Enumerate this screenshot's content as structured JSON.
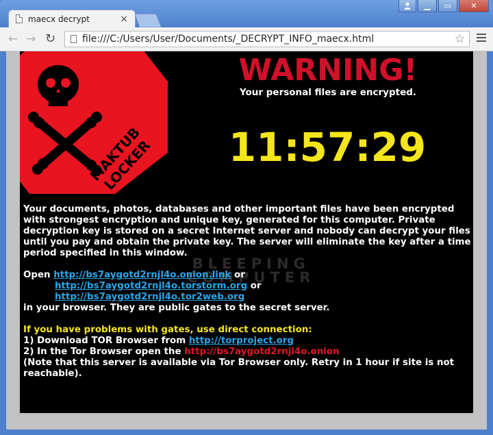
{
  "browser": {
    "tab_title": "maecx decrypt",
    "tab_close": "×",
    "url": "file:///C:/Users/User/Documents/_DECRYPT_INFO_maecx.html",
    "back_glyph": "←",
    "forward_glyph": "→",
    "reload_glyph": "↻",
    "star_glyph": "☆",
    "minimize_glyph": "▁",
    "maximize_glyph": "▭",
    "close_glyph": "✕",
    "user_glyph": "👤"
  },
  "logo": {
    "line1": "MAKTUB",
    "line2": "LOCKER",
    "color": "#e8141f"
  },
  "header": {
    "warning": "WARNING!",
    "subtitle": "Your personal files are encrypted."
  },
  "timer": "11:57:29",
  "watermark": {
    "line1": "BLEEPING",
    "line2": "COMPUTER"
  },
  "message": {
    "paragraph1": "Your documents, photos, databases and other important files have been encrypted with strongest encryption and unique key, generated for this computer. Private decryption key is stored on a secret Internet server and nobody can decrypt your files until you pay and obtain the private key. The server will eliminate the key after a time period specified in this window.",
    "open_label": "Open",
    "link1": "http://bs7aygotd2rnjl4o.onion.link",
    "or1": "or",
    "link2": "http://bs7aygotd2rnjl4o.torstorm.org",
    "or2": "or",
    "link3": "http://bs7aygotd2rnjl4o.tor2web.org",
    "browser_line": "in your browser. They are public gates to the secret server.",
    "gates_problem": "If you have problems with gates, use direct connection:",
    "step1_prefix": "1) Download TOR Browser from",
    "step1_link": "http://torproject.org",
    "step2_prefix": "2) In the Tor Browser open the",
    "step2_link": "http://bs7aygotd2rnjl4o.onion",
    "note": "(Note that this server is available via Tor Browser only. Retry in 1 hour if site is not reachable)."
  },
  "colors": {
    "warning_red": "#d1102a",
    "timer_yellow": "#f5e51c",
    "link_blue": "#2aa6e8",
    "onion_red": "#e01622",
    "page_bg": "#000000"
  }
}
